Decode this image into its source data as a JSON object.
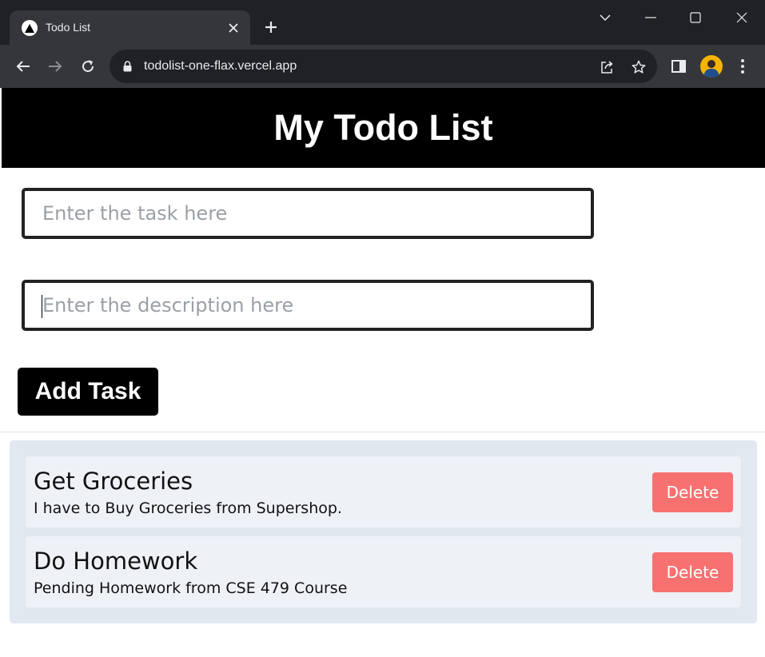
{
  "browser": {
    "tab_title": "Todo List",
    "url": "todolist-one-flax.vercel.app"
  },
  "page": {
    "title": "My Todo List",
    "task_placeholder": "Enter the task here",
    "description_placeholder": "Enter the description here",
    "add_button_label": "Add Task"
  },
  "todos": [
    {
      "title": "Get Groceries",
      "description": "I have to Buy Groceries from Supershop.",
      "delete_label": "Delete"
    },
    {
      "title": "Do Homework",
      "description": "Pending Homework from CSE 479 Course",
      "delete_label": "Delete"
    }
  ],
  "colors": {
    "header_bg": "#000000",
    "delete_button": "#f87171",
    "list_bg": "#e2e8f0",
    "item_bg": "#eef2f7"
  }
}
